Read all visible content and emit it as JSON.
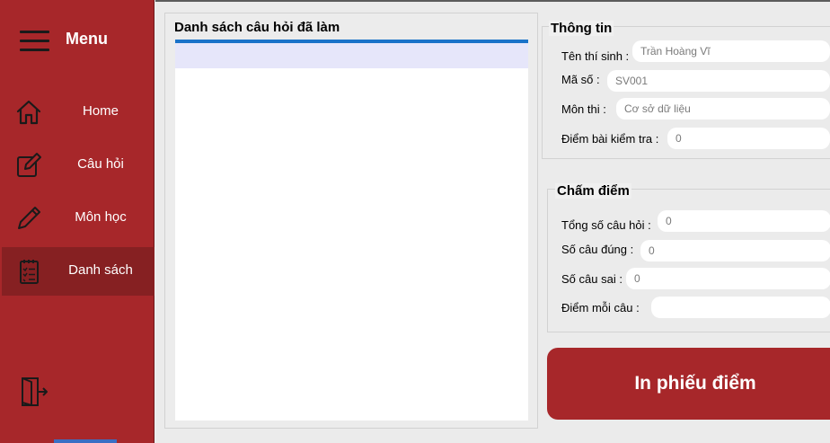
{
  "sidebar": {
    "title": "Menu",
    "items": [
      {
        "label": "Home",
        "icon": "home-icon"
      },
      {
        "label": "Câu hỏi",
        "icon": "edit-icon"
      },
      {
        "label": "Môn học",
        "icon": "pencil-icon"
      },
      {
        "label": "Danh sách",
        "icon": "checklist-icon"
      }
    ],
    "active_index": 3,
    "colors": {
      "background": "#a7272a",
      "active": "#862022"
    }
  },
  "question_list": {
    "title": "Danh sách câu hỏi đã làm",
    "accent": "#1a73c9"
  },
  "info": {
    "title": "Thông tin",
    "student_name_label": "Tên thí sinh :",
    "student_name_value": "Trần Hoàng Vĩ",
    "student_id_label": "Mã số :",
    "student_id_value": "SV001",
    "subject_label": "Môn thi :",
    "subject_value": "Cơ sở dữ liệu",
    "score_label": "Điểm bài kiểm tra :",
    "score_value": "0"
  },
  "grading": {
    "title": "Chấm điểm",
    "total_label": "Tổng số câu hỏi :",
    "total_value": "0",
    "correct_label": "Số câu đúng :",
    "correct_value": "0",
    "wrong_label": "Số câu sai :",
    "wrong_value": "0",
    "per_question_label": "Điểm mỗi câu :",
    "per_question_value": ""
  },
  "print_button": "In phiếu điểm"
}
